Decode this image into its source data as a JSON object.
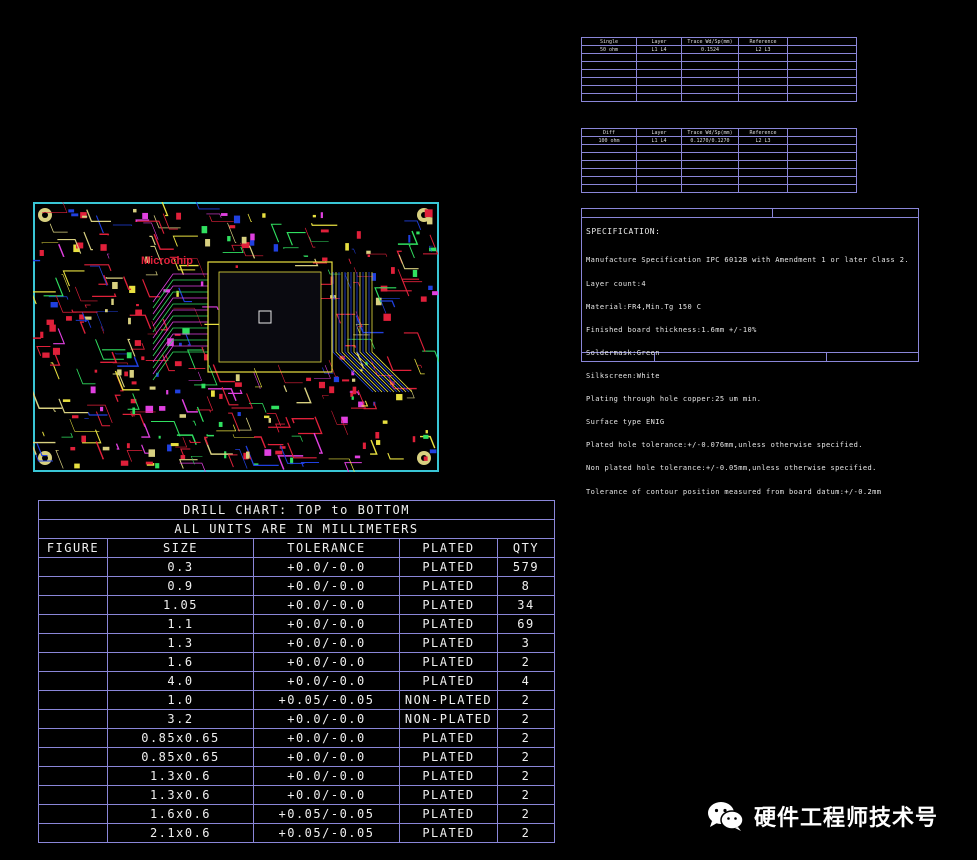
{
  "imp_table_1": {
    "headers": [
      "Single",
      "Layer",
      "Trace Wd/Sp(mm)",
      "Reference"
    ],
    "row1": [
      "50 ohm",
      "L1 L4",
      "0.1524",
      "L2 L3"
    ]
  },
  "imp_table_2": {
    "headers": [
      "Diff",
      "Layer",
      "Trace Wd/Sp(mm)",
      "Reference"
    ],
    "row1": [
      "100 ohm",
      "L1 L4",
      "0.1270/0.1270",
      "L2 L3"
    ]
  },
  "spec": {
    "title": "SPECIFICATION:",
    "lines": [
      "Manufacture Specification IPC 6012B with Amendment 1 or later Class 2.",
      "Layer count:4",
      "Material:FR4,Min.Tg 150 C",
      "Finished board thickness:1.6mm +/-10%",
      "Soldermask:Green",
      "Silkscreen:White",
      "Plating through hole copper:25 um min.",
      "Surface type ENIG",
      "Plated hole tolerance:+/-0.076mm,unless otherwise specified.",
      "Non plated hole tolerance:+/-0.05mm,unless otherwise specified.",
      "Tolerance of contour position measured from board datum:+/-0.2mm"
    ]
  },
  "pcb": {
    "logo_text": "Microchip",
    "colors": {
      "outline": "#39c6d6",
      "trace_red": "#e0203a",
      "trace_yellow": "#e8e040",
      "trace_blue": "#2040e0",
      "trace_green": "#30e060",
      "trace_magenta": "#e040e0",
      "pad": "#d8d080"
    }
  },
  "drill_chart": {
    "title": "DRILL CHART: TOP to BOTTOM",
    "subtitle": "ALL UNITS ARE IN MILLIMETERS",
    "headers": [
      "FIGURE",
      "SIZE",
      "TOLERANCE",
      "PLATED",
      "QTY"
    ],
    "rows": [
      [
        "",
        "0.3",
        "+0.0/-0.0",
        "PLATED",
        "579"
      ],
      [
        "",
        "0.9",
        "+0.0/-0.0",
        "PLATED",
        "8"
      ],
      [
        "",
        "1.05",
        "+0.0/-0.0",
        "PLATED",
        "34"
      ],
      [
        "",
        "1.1",
        "+0.0/-0.0",
        "PLATED",
        "69"
      ],
      [
        "",
        "1.3",
        "+0.0/-0.0",
        "PLATED",
        "3"
      ],
      [
        "",
        "1.6",
        "+0.0/-0.0",
        "PLATED",
        "2"
      ],
      [
        "",
        "4.0",
        "+0.0/-0.0",
        "PLATED",
        "4"
      ],
      [
        "",
        "1.0",
        "+0.05/-0.05",
        "NON-PLATED",
        "2"
      ],
      [
        "",
        "3.2",
        "+0.0/-0.0",
        "NON-PLATED",
        "2"
      ],
      [
        "",
        "0.85x0.65",
        "+0.0/-0.0",
        "PLATED",
        "2"
      ],
      [
        "",
        "0.85x0.65",
        "+0.0/-0.0",
        "PLATED",
        "2"
      ],
      [
        "",
        "1.3x0.6",
        "+0.0/-0.0",
        "PLATED",
        "2"
      ],
      [
        "",
        "1.3x0.6",
        "+0.0/-0.0",
        "PLATED",
        "2"
      ],
      [
        "",
        "1.6x0.6",
        "+0.05/-0.05",
        "PLATED",
        "2"
      ],
      [
        "",
        "2.1x0.6",
        "+0.05/-0.05",
        "PLATED",
        "2"
      ]
    ]
  },
  "watermark": {
    "text": "硬件工程师技术号",
    "icon": "wechat-icon"
  }
}
